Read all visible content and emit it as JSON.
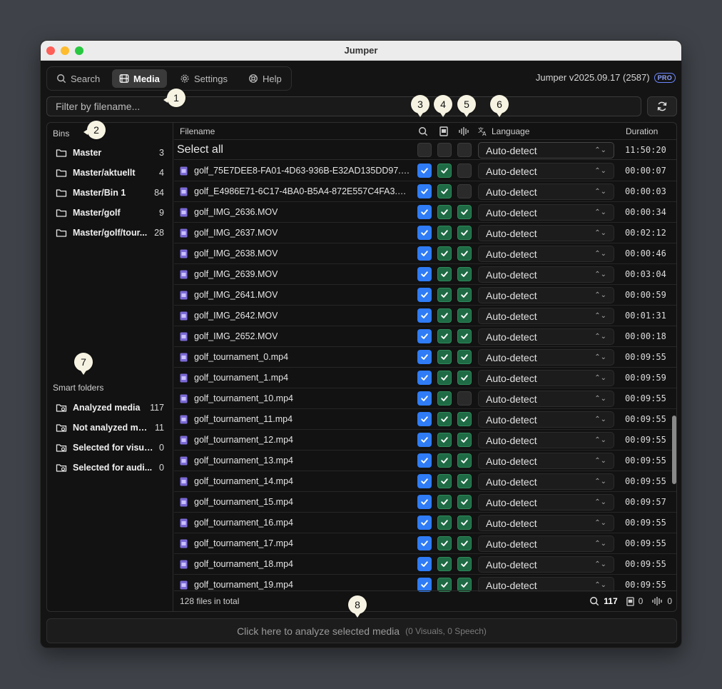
{
  "window": {
    "title": "Jumper"
  },
  "nav": {
    "search": "Search",
    "media": "Media",
    "settings": "Settings",
    "help": "Help"
  },
  "version": "Jumper v2025.09.17 (2587)",
  "badge": "PRO",
  "filter": {
    "placeholder": "Filter by filename..."
  },
  "bins": {
    "label": "Bins",
    "items": [
      {
        "name": "Master",
        "count": "3"
      },
      {
        "name": "Master/aktuellt",
        "count": "4"
      },
      {
        "name": "Master/Bin 1",
        "count": "84"
      },
      {
        "name": "Master/golf",
        "count": "9"
      },
      {
        "name": "Master/golf/tour...",
        "count": "28"
      }
    ]
  },
  "smart_folders": {
    "label": "Smart folders",
    "items": [
      {
        "name": "Analyzed media",
        "count": "117"
      },
      {
        "name": "Not analyzed me...",
        "count": "11"
      },
      {
        "name": "Selected for visua...",
        "count": "0"
      },
      {
        "name": "Selected for audi...",
        "count": "0"
      }
    ]
  },
  "table": {
    "headers": {
      "filename": "Filename",
      "language": "Language",
      "duration": "Duration"
    },
    "select_all": {
      "label": "Select all",
      "language": "Auto-detect",
      "duration": "11:50:20"
    },
    "rows": [
      {
        "name": "golf_75E7DEE8-FA01-4D63-936B-E32AD135DD97.mov",
        "search": true,
        "visual": true,
        "speech": false,
        "language": "Auto-detect",
        "duration": "00:00:07"
      },
      {
        "name": "golf_E4986E71-6C17-4BA0-B5A4-872E557C4FA3.mov",
        "search": true,
        "visual": true,
        "speech": false,
        "language": "Auto-detect",
        "duration": "00:00:03"
      },
      {
        "name": "golf_IMG_2636.MOV",
        "search": true,
        "visual": true,
        "speech": true,
        "language": "Auto-detect",
        "duration": "00:00:34"
      },
      {
        "name": "golf_IMG_2637.MOV",
        "search": true,
        "visual": true,
        "speech": true,
        "language": "Auto-detect",
        "duration": "00:02:12"
      },
      {
        "name": "golf_IMG_2638.MOV",
        "search": true,
        "visual": true,
        "speech": true,
        "language": "Auto-detect",
        "duration": "00:00:46"
      },
      {
        "name": "golf_IMG_2639.MOV",
        "search": true,
        "visual": true,
        "speech": true,
        "language": "Auto-detect",
        "duration": "00:03:04"
      },
      {
        "name": "golf_IMG_2641.MOV",
        "search": true,
        "visual": true,
        "speech": true,
        "language": "Auto-detect",
        "duration": "00:00:59"
      },
      {
        "name": "golf_IMG_2642.MOV",
        "search": true,
        "visual": true,
        "speech": true,
        "language": "Auto-detect",
        "duration": "00:01:31"
      },
      {
        "name": "golf_IMG_2652.MOV",
        "search": true,
        "visual": true,
        "speech": true,
        "language": "Auto-detect",
        "duration": "00:00:18"
      },
      {
        "name": "golf_tournament_0.mp4",
        "search": true,
        "visual": true,
        "speech": true,
        "language": "Auto-detect",
        "duration": "00:09:55"
      },
      {
        "name": "golf_tournament_1.mp4",
        "search": true,
        "visual": true,
        "speech": true,
        "language": "Auto-detect",
        "duration": "00:09:59"
      },
      {
        "name": "golf_tournament_10.mp4",
        "search": true,
        "visual": true,
        "speech": false,
        "language": "Auto-detect",
        "duration": "00:09:55"
      },
      {
        "name": "golf_tournament_11.mp4",
        "search": true,
        "visual": true,
        "speech": true,
        "language": "Auto-detect",
        "duration": "00:09:55"
      },
      {
        "name": "golf_tournament_12.mp4",
        "search": true,
        "visual": true,
        "speech": true,
        "language": "Auto-detect",
        "duration": "00:09:55"
      },
      {
        "name": "golf_tournament_13.mp4",
        "search": true,
        "visual": true,
        "speech": true,
        "language": "Auto-detect",
        "duration": "00:09:55"
      },
      {
        "name": "golf_tournament_14.mp4",
        "search": true,
        "visual": true,
        "speech": true,
        "language": "Auto-detect",
        "duration": "00:09:55"
      },
      {
        "name": "golf_tournament_15.mp4",
        "search": true,
        "visual": true,
        "speech": true,
        "language": "Auto-detect",
        "duration": "00:09:57"
      },
      {
        "name": "golf_tournament_16.mp4",
        "search": true,
        "visual": true,
        "speech": true,
        "language": "Auto-detect",
        "duration": "00:09:55"
      },
      {
        "name": "golf_tournament_17.mp4",
        "search": true,
        "visual": true,
        "speech": true,
        "language": "Auto-detect",
        "duration": "00:09:55"
      },
      {
        "name": "golf_tournament_18.mp4",
        "search": true,
        "visual": true,
        "speech": true,
        "language": "Auto-detect",
        "duration": "00:09:55"
      },
      {
        "name": "golf_tournament_19.mp4",
        "search": true,
        "visual": true,
        "speech": true,
        "language": "Auto-detect",
        "duration": "00:09:55"
      }
    ]
  },
  "footer": {
    "total": "128 files in total",
    "search_count": "117",
    "visual_count": "0",
    "speech_count": "0"
  },
  "analyze": {
    "label": "Click here to analyze selected media",
    "sub": "(0 Visuals, 0 Speech)"
  },
  "callouts": [
    "1",
    "2",
    "3",
    "4",
    "5",
    "6",
    "7",
    "8"
  ],
  "colors": {
    "check_blue": "#2f7cf6",
    "check_green": "#1e6b45",
    "pro_badge": "#6b86ff"
  }
}
